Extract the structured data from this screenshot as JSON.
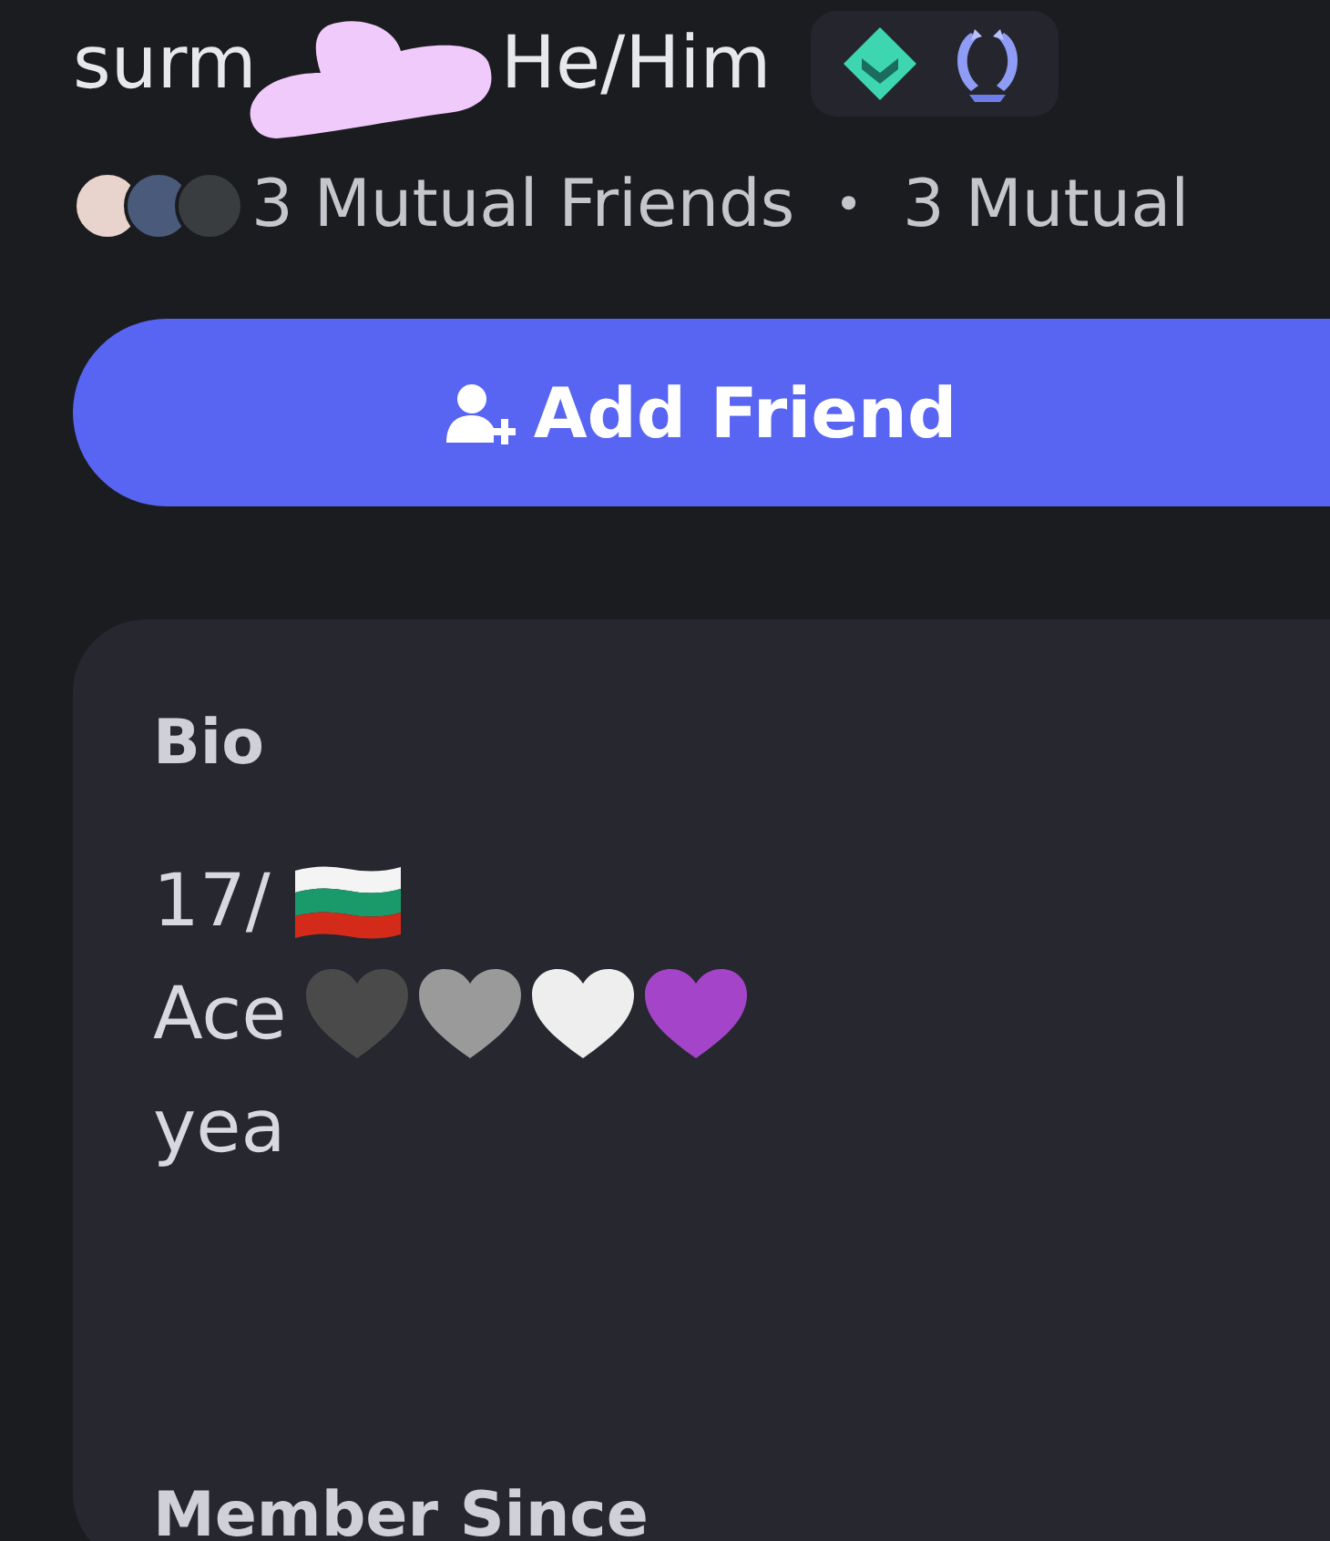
{
  "profile": {
    "name": "surm",
    "pronouns": "He/Him",
    "redacted": true
  },
  "badges": [
    {
      "kind": "diamond"
    },
    {
      "kind": "wreath"
    }
  ],
  "mutuals": {
    "avatars": [
      {
        "color": "#e8d4cc"
      },
      {
        "color": "#4a5a7a"
      },
      {
        "color": "#3a3d40"
      }
    ],
    "friends": "3 Mutual Friends",
    "separator": "•",
    "servers": "3 Mutual"
  },
  "add_friend_button": {
    "label": "Add Friend"
  },
  "bio": {
    "title": "Bio",
    "lines": [
      {
        "text": "17/",
        "kind": "flag"
      },
      {
        "text": "Ace",
        "kind": "hearts",
        "hearts": [
          {
            "color": "#4a4a4a"
          },
          {
            "color": "#9a9a9a"
          },
          {
            "color": "#eeeeee"
          },
          {
            "color": "#a444c8"
          }
        ]
      },
      {
        "text": "yea",
        "kind": "plain"
      }
    ]
  },
  "member_since": {
    "title": "Member Since"
  }
}
